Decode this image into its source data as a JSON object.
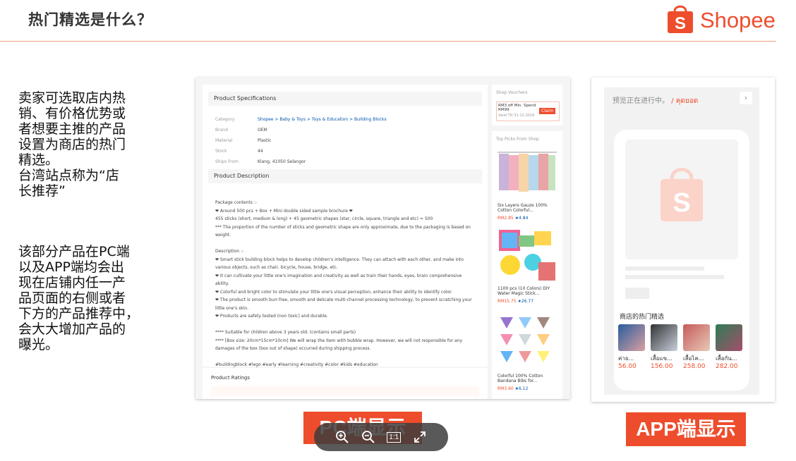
{
  "header": {
    "title": "热门精选是什么？",
    "brand": "Shopee"
  },
  "left": {
    "para1": "卖家可选取店内热\n销、有价格优势或\n者想要主推的产品\n设置为商店的热门\n精选。\n台湾站点称为“店\n长推荐”",
    "para2": "该部分产品在PC端\n以及APP端均会出\n现在店铺内任一产\n品页面的右侧或者\n下方的产品推荐中，\n会大大增加产品的\n曝光。"
  },
  "pc": {
    "spec_title": "Product Specifications",
    "specs": [
      {
        "k": "Category",
        "v": "Shopee > Baby & Toys > Toys & Education > Building Blocks"
      },
      {
        "k": "Brand",
        "v": "OEM"
      },
      {
        "k": "Material",
        "v": "Plastic"
      },
      {
        "k": "Stock",
        "v": "44"
      },
      {
        "k": "Ships From",
        "v": "Klang, 41050 Selangor"
      }
    ],
    "desc_title": "Product Description",
    "desc_lines": [
      "Package contents :-",
      "❤ Around 500 pcs + Box + Mini double sided sample brochure ❤",
      "455 sticks (short, medium & long) + 45 geometric shapes (star, circle, square, triangle and etc) = 500",
      "*** The proportion of the number of sticks and geometric shape are only approximate, due to the packaging is based on weight.",
      "",
      "Description :-",
      "❤ Smart stick building block helps to develop children's intelligence. They can attach with each other, and make into various objects, such as chair, bicycle, house, bridge, etc.",
      "❤ It can cultivate your little one's imagination and creativity as well as train their hands, eyes, brain comprehensive ability.",
      "❤ Colorful and bright color to stimulate your little one's visual perception, enhance their ability to identify color.",
      "❤ The product is smooth burr-free, smooth and delicate multi-channel processing technology, to prevent scratching your little one's skin.",
      "❤ Products are safety tested (non toxic) and durable.",
      "",
      "**** Suitable for children above 3 years old. (contains small parts)",
      "**** [Box size: 20cm*15cm*10cm] We will wrap the item with bubble wrap. However, we will not responsible for any damages of the box (box out of shape) occurred during shipping process.",
      "",
      "#buildingblock #lego #early #learning #creativity #color #kids #education"
    ],
    "ratings_title": "Product Ratings",
    "vouchers_title": "Shop Vouchers",
    "voucher_text": "RM3 off Min. Spend RM99",
    "voucher_valid": "Valid Till 31-12-2019",
    "claim": "Claim",
    "top_picks_title": "Top Picks From Shop",
    "picks": [
      {
        "name": "Six Layers Gauze 100% Cotton Colorful...",
        "price": "RM2.85",
        "rating": "4.84"
      },
      {
        "name": "1100 pcs (10 Colors) DIY Water Magic Stick...",
        "price": "RM15.75",
        "rating": "26.77"
      },
      {
        "name": "Colorful 100% Cotton Bandana Bibs for...",
        "price": "RM3.60",
        "rating": "6.12"
      }
    ],
    "label": "PC端显示"
  },
  "app": {
    "banner_text": "预览正在进行中。",
    "banner_thai": "/ คุดยอด",
    "section_title": "商店的热门精选",
    "items": [
      {
        "name": "ค่าย...",
        "price": "56.00"
      },
      {
        "name": "เสื้อแข...",
        "price": "156.00"
      },
      {
        "name": "เสื้อไค...",
        "price": "258.00"
      },
      {
        "name": "เสื้อกัน...",
        "price": "282.00"
      }
    ],
    "label": "APP端显示"
  },
  "viewer": {
    "reset_label": "1:1"
  },
  "colors": {
    "accent": "#ee4d2d"
  }
}
